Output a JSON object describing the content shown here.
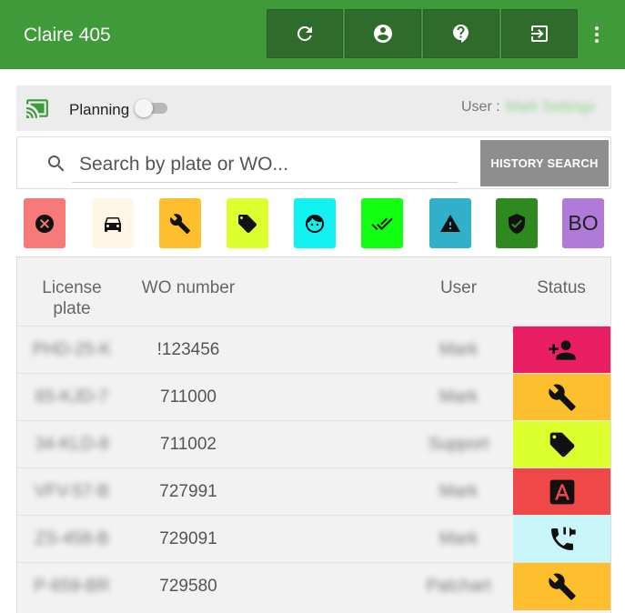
{
  "app": {
    "title": "Claire 405"
  },
  "toolbar": {
    "buttons": [
      {
        "name": "refresh-icon"
      },
      {
        "name": "account-icon"
      },
      {
        "name": "help-icon"
      },
      {
        "name": "logout-icon"
      }
    ],
    "more": "more-vert-icon"
  },
  "planning": {
    "label": "Planning",
    "enabled": false,
    "user_label": "User :",
    "user_value": "Mark Settings"
  },
  "search": {
    "placeholder": "Search by plate or WO...",
    "value": "",
    "history_button": "HISTORY SEARCH"
  },
  "filters": [
    {
      "icon": "cancel-icon",
      "color": "#f77a7a"
    },
    {
      "icon": "car-icon",
      "color": "#fff6e6"
    },
    {
      "icon": "wrench-icon",
      "color": "#fdbf2d"
    },
    {
      "icon": "tag-icon",
      "color": "#dcff2e"
    },
    {
      "icon": "face-icon",
      "color": "#12f2f2"
    },
    {
      "icon": "double-check-icon",
      "color": "#11ff11"
    },
    {
      "icon": "warning-icon",
      "color": "#32b0c9"
    },
    {
      "icon": "shield-check-icon",
      "color": "#2e8a1f"
    },
    {
      "label": "BO",
      "color": "#b07ad8"
    }
  ],
  "table": {
    "headers": {
      "plate_line1": "License",
      "plate_line2": "plate",
      "wo": "WO number",
      "user": "User",
      "status": "Status"
    },
    "rows": [
      {
        "plate": "PHD-25-K",
        "wo": "!123456",
        "user": "Mark",
        "status_icon": "person-add-icon",
        "status_color": "#e91e63"
      },
      {
        "plate": "65-KJD-7",
        "wo": "711000",
        "user": "Mark",
        "status_icon": "wrench-icon",
        "status_color": "#fdbf2d"
      },
      {
        "plate": "34-KLD-8",
        "wo": "711002",
        "user": "Support",
        "status_icon": "tag-icon",
        "status_color": "#dcff2e"
      },
      {
        "plate": "VFV-57-B",
        "wo": "727991",
        "user": "Mark",
        "status_icon": "font-a-icon",
        "status_color": "#f04848"
      },
      {
        "plate": "ZS-458-B",
        "wo": "729091",
        "user": "Mark",
        "status_icon": "phone-callback-icon",
        "status_color": "#c9f6fb"
      },
      {
        "plate": "P-659-BR",
        "wo": "729580",
        "user": "Patchart",
        "status_icon": "wrench-icon",
        "status_color": "#fdbf2d"
      }
    ]
  }
}
